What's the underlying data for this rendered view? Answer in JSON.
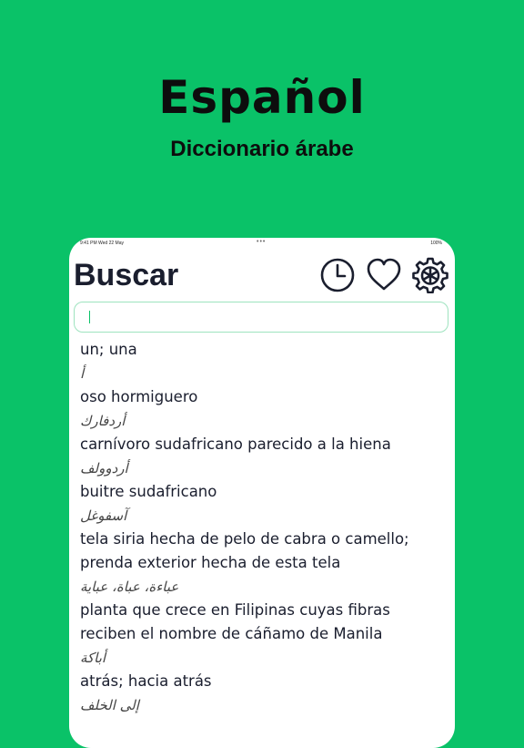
{
  "promo": {
    "title": "Español",
    "subtitle": "Diccionario árabe"
  },
  "status_bar": {
    "time": "9:41 PM  Wed 22 May",
    "dots": "•••",
    "right": "100%"
  },
  "header": {
    "title": "Buscar",
    "icons": [
      "history-clock-icon",
      "heart-icon",
      "gear-icon"
    ]
  },
  "search": {
    "value": "",
    "placeholder": ""
  },
  "entries": [
    {
      "es": "un; una",
      "ar": "أ"
    },
    {
      "es": "oso hormiguero",
      "ar": "أردفارك"
    },
    {
      "es": "carnívoro sudafricano parecido a la hiena",
      "ar": "أردوولف"
    },
    {
      "es": "buitre sudafricano",
      "ar": "آسفوغل"
    },
    {
      "es": "tela siria hecha de pelo de cabra o camello; prenda exterior hecha de esta tela",
      "ar": "عباءة، عباة، عباية"
    },
    {
      "es": "planta que crece en Filipinas cuyas fibras reciben el nombre de cáñamo de Manila",
      "ar": "أباكة"
    },
    {
      "es": "atrás; hacia atrás",
      "ar": "إلى الخلف"
    }
  ],
  "colors": {
    "background": "#0ac268",
    "accent": "#0ac268",
    "text": "#1a1e2e"
  }
}
